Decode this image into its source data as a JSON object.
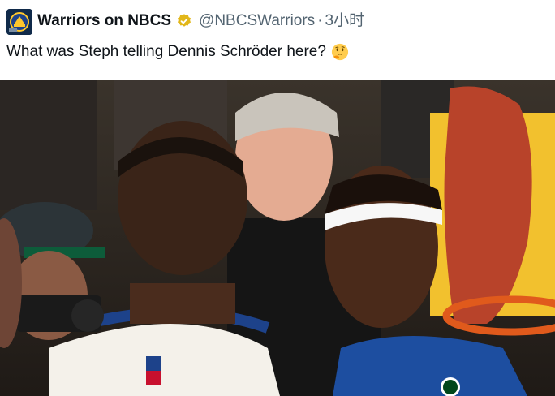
{
  "tweet": {
    "display_name": "Warriors on NBCS",
    "handle": "@NBCSWarriors",
    "separator": "·",
    "timestamp": "3小时",
    "text": "What was Steph telling Dennis Schröder here?",
    "emoji": "thinking-face"
  },
  "colors": {
    "text": "#0f1419",
    "secondary": "#536471",
    "verified_badge": "#e2b719"
  }
}
